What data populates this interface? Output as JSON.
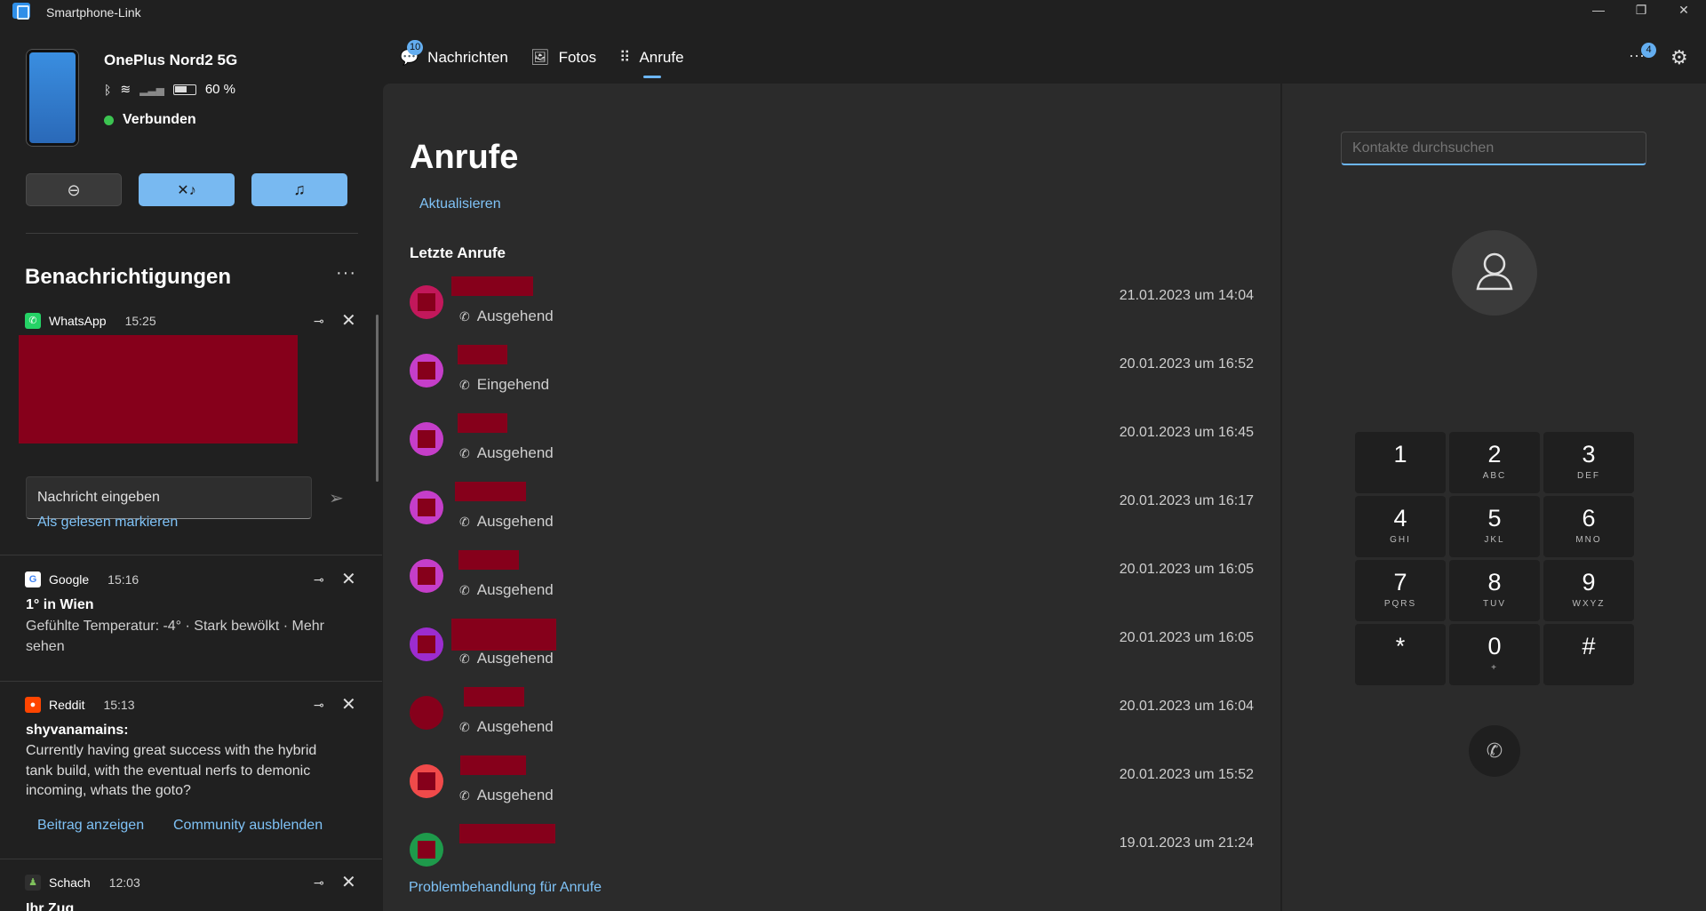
{
  "window": {
    "title": "Smartphone-Link",
    "controls": {
      "minimize": "—",
      "restore": "❐",
      "close": "✕"
    }
  },
  "device": {
    "name": "OnePlus Nord2 5G",
    "battery": "60 %",
    "status": "Verbunden"
  },
  "quick_actions": [
    {
      "icon": "do-not-disturb-icon",
      "glyph": "⊖",
      "active": false
    },
    {
      "icon": "mute-icon",
      "glyph": "🔇",
      "active": true
    },
    {
      "icon": "music-icon",
      "glyph": "♫",
      "active": true
    }
  ],
  "notifications": {
    "heading": "Benachrichtigungen",
    "more": "···",
    "items": [
      {
        "app": "WhatsApp",
        "time": "15:25",
        "reply_placeholder": "Nachricht eingeben",
        "action": "Als gelesen markieren"
      },
      {
        "app": "Google",
        "time": "15:16",
        "title": "1° in Wien",
        "body": "Gefühlte Temperatur: -4° · Stark bewölkt · Mehr sehen"
      },
      {
        "app": "Reddit",
        "time": "15:13",
        "title": "shyvanamains:",
        "body": "Currently having great success with the hybrid tank build, with the eventual nerfs to demonic incoming, whats the goto?",
        "actions": [
          "Beitrag anzeigen",
          "Community ausblenden"
        ]
      },
      {
        "app": "Schach",
        "time": "12:03",
        "title": "Ihr Zug"
      }
    ]
  },
  "tabs": [
    {
      "label": "Nachrichten",
      "icon": "chat-icon",
      "badge": "10"
    },
    {
      "label": "Fotos",
      "icon": "photos-icon"
    },
    {
      "label": "Anrufe",
      "icon": "dialpad-icon",
      "active": true
    }
  ],
  "top_right": {
    "more": "···",
    "badge": "4"
  },
  "calls": {
    "title": "Anrufe",
    "refresh": "Aktualisieren",
    "recent_heading": "Letzte Anrufe",
    "items": [
      {
        "type": "Ausgehend",
        "date": "21.01.2023 um 14:04",
        "avatar_color": "#c2185b"
      },
      {
        "type": "Eingehend",
        "date": "20.01.2023 um 16:52",
        "avatar_color": "#c53ec9"
      },
      {
        "type": "Ausgehend",
        "date": "20.01.2023 um 16:45",
        "avatar_color": "#c53ec9"
      },
      {
        "type": "Ausgehend",
        "date": "20.01.2023 um 16:17",
        "avatar_color": "#c53ec9"
      },
      {
        "type": "Ausgehend",
        "date": "20.01.2023 um 16:05",
        "avatar_color": "#c53ec9"
      },
      {
        "type": "Ausgehend",
        "date": "20.01.2023 um 16:05",
        "avatar_color": "#9c2ccf"
      },
      {
        "type": "Ausgehend",
        "date": "20.01.2023 um 16:04",
        "avatar_color": "#86001b"
      },
      {
        "type": "Ausgehend",
        "date": "20.01.2023 um 15:52",
        "avatar_color": "#f04a4a"
      },
      {
        "type": "",
        "date": "19.01.2023 um 21:24",
        "avatar_color": "#1e9a4b"
      }
    ],
    "troubleshoot": "Problembehandlung für Anrufe"
  },
  "dialer": {
    "search_placeholder": "Kontakte durchsuchen",
    "keys": [
      {
        "num": "1",
        "sub": ""
      },
      {
        "num": "2",
        "sub": "ABC"
      },
      {
        "num": "3",
        "sub": "DEF"
      },
      {
        "num": "4",
        "sub": "GHI"
      },
      {
        "num": "5",
        "sub": "JKL"
      },
      {
        "num": "6",
        "sub": "MNO"
      },
      {
        "num": "7",
        "sub": "PQRS"
      },
      {
        "num": "8",
        "sub": "TUV"
      },
      {
        "num": "9",
        "sub": "WXYZ"
      },
      {
        "num": "*",
        "sub": ""
      },
      {
        "num": "0",
        "sub": "+"
      },
      {
        "num": "#",
        "sub": ""
      }
    ]
  },
  "colors": {
    "accent": "#6cb6f5",
    "link": "#7fc2f6",
    "connected": "#3cc451",
    "redaction": "#86001b"
  }
}
